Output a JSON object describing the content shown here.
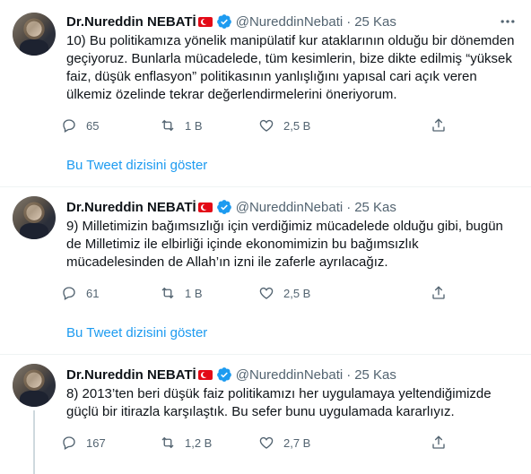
{
  "tweets": [
    {
      "author": "Dr.Nureddin NEBATİ",
      "handle": "@NureddinNebati",
      "separator": "·",
      "date": "25 Kas",
      "text": "10) Bu politikamıza yönelik manipülatif kur ataklarının olduğu bir dönemden geçiyoruz. Bunlarla mücadelede, tüm kesimlerin, bize dikte edilmiş “yüksek faiz, düşük enflasyon” politikasının yanlışlığını yapısal cari açık veren ülkemiz özelinde tekrar değerlendirmelerini öneriyorum.",
      "replies": "65",
      "retweets": "1 B",
      "likes": "2,5 B",
      "show_thread": "Bu Tweet dizisini göster"
    },
    {
      "author": "Dr.Nureddin NEBATİ",
      "handle": "@NureddinNebati",
      "separator": "·",
      "date": "25 Kas",
      "text": "9) Milletimizin bağımsızlığı için verdiğimiz mücadelede olduğu gibi, bugün de Milletimiz ile elbirliği içinde ekonomimizin bu bağımsızlık mücadelesinden de Allah’ın izni ile zaferle ayrılacağız.",
      "replies": "61",
      "retweets": "1 B",
      "likes": "2,5 B",
      "show_thread": "Bu Tweet dizisini göster"
    },
    {
      "author": "Dr.Nureddin NEBATİ",
      "handle": "@NureddinNebati",
      "separator": "·",
      "date": "25 Kas",
      "text": "8) 2013’ten beri düşük faiz politikamızı her uygulamaya yeltendiğimizde güçlü bir itirazla karşılaştık. Bu sefer bunu uygulamada kararlıyız.",
      "replies": "167",
      "retweets": "1,2 B",
      "likes": "2,7 B"
    }
  ],
  "icons": {
    "reply": "reply-icon",
    "retweet": "retweet-icon",
    "like": "heart-icon",
    "share": "share-icon",
    "more": "more-icon",
    "verified": "verified-badge-icon",
    "flag": "turkey-flag-icon"
  },
  "colors": {
    "accent": "#1d9bf0",
    "secondary_text": "#536471",
    "divider": "#eff3f4",
    "flag_red": "#e30a17"
  }
}
